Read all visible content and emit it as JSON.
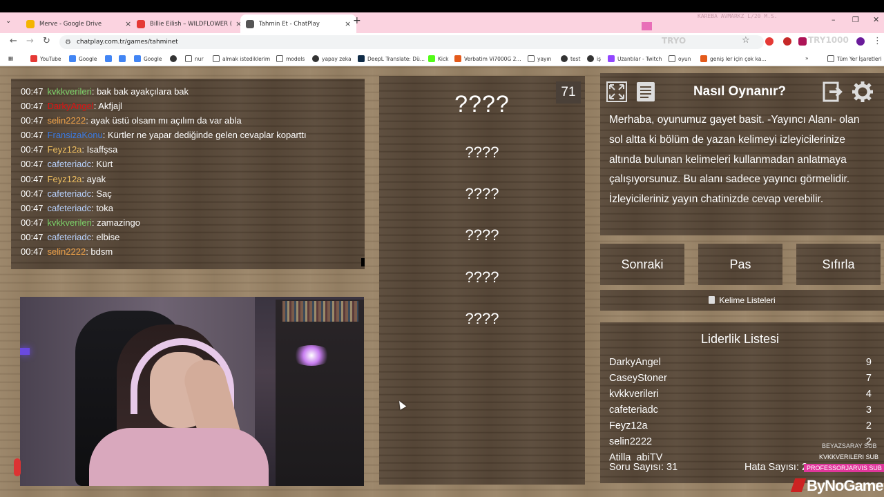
{
  "browser": {
    "tabs": [
      {
        "title": "Merve - Google Drive",
        "icon_color": "#f4b400",
        "icon": "google-drive-icon"
      },
      {
        "title": "Billie Eilish – WILDFLOWER (Live",
        "icon_color": "#e53935",
        "icon": "youtube-icon"
      },
      {
        "title": "Tahmin Et - ChatPlay",
        "icon_color": "#555555",
        "icon": "chatplay-icon"
      }
    ],
    "url": "chatplay.com.tr/games/tahminet",
    "overlay_text_1": "TRYO",
    "overlay_text_2": "TRY1000",
    "bookmarks": [
      {
        "label": "YouTube",
        "color": "#e53935"
      },
      {
        "label": "Google",
        "color": "#4285f4"
      },
      {
        "label": "",
        "color": "#4285f4"
      },
      {
        "label": "",
        "color": "#4285f4"
      },
      {
        "label": "Google",
        "color": "#4285f4"
      },
      {
        "label": "",
        "color": "#333333"
      },
      {
        "label": "nur",
        "color": "#555555"
      },
      {
        "label": "almak istediklerim",
        "color": "#555555"
      },
      {
        "label": "models",
        "color": "#555555"
      },
      {
        "label": "yapay zeka",
        "color": "#333333"
      },
      {
        "label": "DeepL Translate: Dü...",
        "color": "#0f2b46"
      },
      {
        "label": "Kick",
        "color": "#53fc18"
      },
      {
        "label": "Verbatim Vi7000G 2...",
        "color": "#e35a1b"
      },
      {
        "label": "yayın",
        "color": "#555555"
      },
      {
        "label": "test",
        "color": "#333333"
      },
      {
        "label": "iş",
        "color": "#333333"
      },
      {
        "label": "Uzantılar - Twitch",
        "color": "#9146ff"
      },
      {
        "label": "oyun",
        "color": "#555555"
      },
      {
        "label": "geniş ler için çok ka...",
        "color": "#e35a1b"
      }
    ],
    "all_bookmarks": "Tüm Yer İşaretleri"
  },
  "chat": [
    {
      "time": "00:47",
      "user": "kvkkverileri",
      "color": "#7dd36a",
      "text": ": bak bak ayakçılara bak"
    },
    {
      "time": "00:47",
      "user": "DarkyAngel",
      "color": "#d11",
      "text": ": Akfjajl"
    },
    {
      "time": "00:47",
      "user": "selin2222",
      "color": "#f0a34a",
      "text": ": ayak üstü olsam mı açılım da var abla"
    },
    {
      "time": "00:47",
      "user": "FransizaKonu",
      "color": "#3b7ae0",
      "text": ": Kürtler ne yapar dediğinde gelen cevaplar koparttı"
    },
    {
      "time": "00:47",
      "user": "Feyz12a",
      "color": "#f0c060",
      "text": ": Isaffşsa"
    },
    {
      "time": "00:47",
      "user": "cafeteriadc",
      "color": "#b9d3ff",
      "text": ": Kürt"
    },
    {
      "time": "00:47",
      "user": "Feyz12a",
      "color": "#f0c060",
      "text": ": ayak"
    },
    {
      "time": "00:47",
      "user": "cafeteriadc",
      "color": "#b9d3ff",
      "text": ": Saç"
    },
    {
      "time": "00:47",
      "user": "cafeteriadc",
      "color": "#b9d3ff",
      "text": ": toka"
    },
    {
      "time": "00:47",
      "user": "kvkkverileri",
      "color": "#7dd36a",
      "text": ": zamazingo"
    },
    {
      "time": "00:47",
      "user": "cafeteriadc",
      "color": "#b9d3ff",
      "text": ": elbise"
    },
    {
      "time": "00:47",
      "user": "selin2222",
      "color": "#f0a34a",
      "text": ": bdsm"
    }
  ],
  "game": {
    "counter": "71",
    "main_word": "????",
    "words": [
      "????",
      "????",
      "????",
      "????",
      "????"
    ]
  },
  "how_to": {
    "title": "Nasıl Oynanır?",
    "text": "Merhaba, oyunumuz gayet basit. -Yayıncı Alanı- olan sol altta ki bölüm de yazan kelimeyi izleyicilerinize altında bulunan kelimeleri kullanmadan anlatmaya çalışıyorsunuz. Bu alanı sadece yayıncı görmelidir. İzleyicileriniz yayın chatinizde cevap verebilir."
  },
  "actions": {
    "next": "Sonraki",
    "pass": "Pas",
    "reset": "Sıfırla",
    "word_lists": "Kelime Listeleri"
  },
  "leaderboard": {
    "title": "Liderlik Listesi",
    "rows": [
      {
        "name": "DarkyAngel",
        "score": "9"
      },
      {
        "name": "CaseyStoner",
        "score": "7"
      },
      {
        "name": "kvkkverileri",
        "score": "4"
      },
      {
        "name": "cafeteriadc",
        "score": "3"
      },
      {
        "name": "Feyz12a",
        "score": "2"
      },
      {
        "name": "selin2222",
        "score": "2"
      },
      {
        "name": "Atilla_abiTV",
        "score": ""
      }
    ],
    "questions_label": "Soru Sayısı: 31",
    "errors_label": "Hata Sayısı: 2"
  },
  "overlay": {
    "subs": [
      {
        "name": "BEYAZSARAY",
        "tag": "SUB"
      },
      {
        "name": "KVKKVERILERI",
        "tag": "SUB"
      },
      {
        "name": "PROFESSORJARVIS",
        "tag": "SUB"
      }
    ],
    "logo": "ByNoGame",
    "top_text": "KAREBA AVMARKZ L/20 M.S."
  }
}
